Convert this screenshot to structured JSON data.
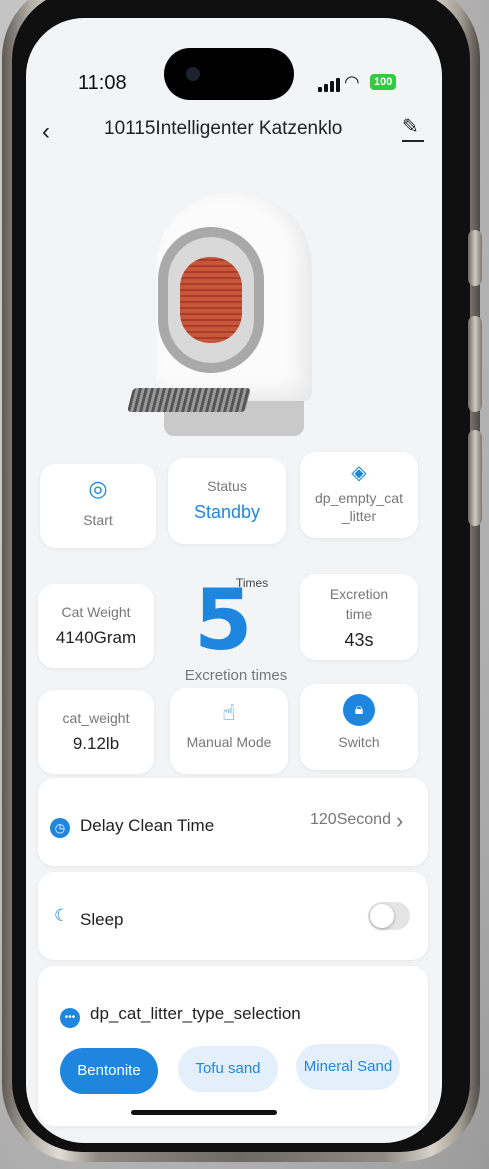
{
  "status_bar": {
    "time": "11:08",
    "battery": "100"
  },
  "header": {
    "title": "10115Intelligenter Katzenklo"
  },
  "status_cards": {
    "start": {
      "label": "Start"
    },
    "status": {
      "label": "Status",
      "value": "Standby"
    },
    "empty": {
      "label": "dp_empty_cat\n_litter"
    }
  },
  "stats": {
    "cat_weight": {
      "label": "Cat Weight",
      "value": "4140Gram"
    },
    "excretion_count": {
      "value": "5",
      "unit": "Times",
      "label": "Excretion times"
    },
    "excretion_time": {
      "label": "Excretion\ntime",
      "value": "43s"
    }
  },
  "controls": {
    "cat_weight_lb": {
      "label": "cat_weight",
      "value": "9.12lb"
    },
    "manual_mode": {
      "label": "Manual Mode"
    },
    "switch": {
      "label": "Switch"
    }
  },
  "delay_clean": {
    "label": "Delay Clean Time",
    "value": "120Second"
  },
  "sleep": {
    "label": "Sleep",
    "on": false
  },
  "litter_type": {
    "label": "dp_cat_litter_type_selection",
    "options": [
      "Bentonite",
      "Tofu sand",
      "Mineral Sand"
    ],
    "selected": "Bentonite"
  },
  "colors": {
    "accent": "#1f86e0",
    "background": "#f3f4f6",
    "battery": "#2ecc40"
  },
  "icons": [
    "signal-icon",
    "wifi-icon",
    "battery-icon",
    "back-icon",
    "edit-icon",
    "swirl-icon",
    "cube-icon",
    "hand-tap-icon",
    "lock-icon",
    "clock-icon",
    "moon-icon",
    "dots-icon",
    "chevron-right-icon"
  ]
}
